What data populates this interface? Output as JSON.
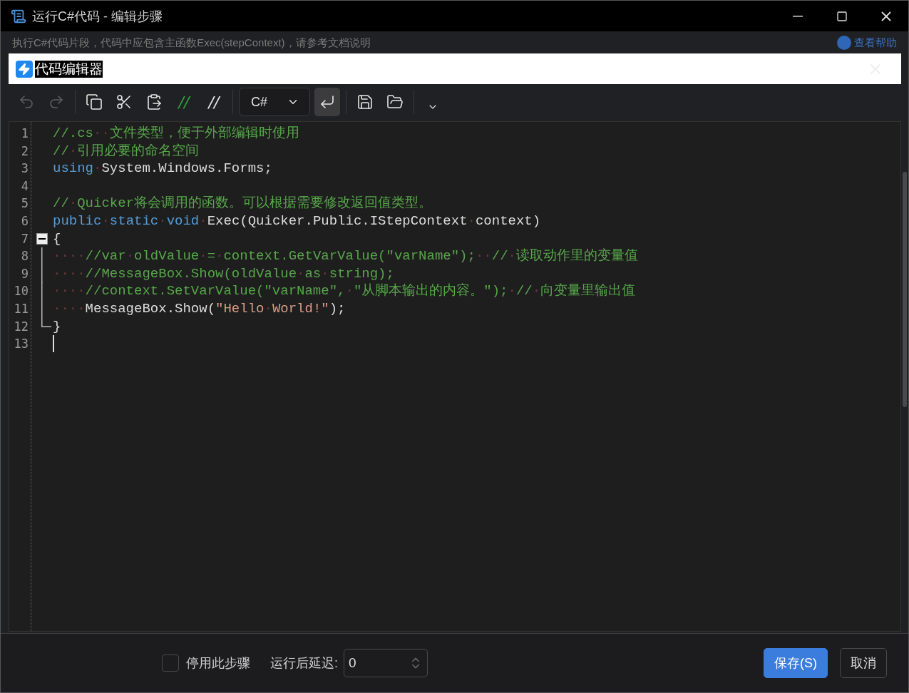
{
  "window": {
    "title": "运行C#代码 - 编辑步骤"
  },
  "background": {
    "description": "执行C#代码片段，代码中应包含主函数Exec(stepContext)，请参考文档说明",
    "help_link": "查看帮助"
  },
  "dialog": {
    "title": "代码编辑器"
  },
  "toolbar": [
    {
      "kind": "undo",
      "disabled": true,
      "selected": false
    },
    {
      "kind": "redo",
      "disabled": true,
      "selected": false
    },
    {
      "kind": "sep"
    },
    {
      "kind": "copy",
      "disabled": false,
      "selected": false
    },
    {
      "kind": "cut",
      "disabled": false,
      "selected": false
    },
    {
      "kind": "paste",
      "disabled": false,
      "selected": false
    },
    {
      "kind": "comment",
      "label": "//",
      "disabled": false,
      "selected": false
    },
    {
      "kind": "uncomment",
      "label": "//",
      "disabled": false,
      "selected": false
    },
    {
      "kind": "sep"
    },
    {
      "kind": "language",
      "value": "C#"
    },
    {
      "kind": "wrap",
      "disabled": false,
      "selected": true
    },
    {
      "kind": "sep"
    },
    {
      "kind": "save",
      "disabled": false,
      "selected": false
    },
    {
      "kind": "open",
      "disabled": false,
      "selected": false
    },
    {
      "kind": "sep"
    },
    {
      "kind": "more",
      "disabled": false,
      "selected": false
    }
  ],
  "editor": {
    "lines": [
      {
        "number": "1",
        "tokens": [
          {
            "kind": "comment",
            "t": "//.cs"
          },
          {
            "kind": "ws",
            "t": "··"
          },
          {
            "kind": "comment",
            "t": "文件类型，便于外部编辑时使用"
          }
        ]
      },
      {
        "number": "2",
        "tokens": [
          {
            "kind": "comment",
            "t": "//"
          },
          {
            "kind": "ws",
            "t": "·"
          },
          {
            "kind": "comment",
            "t": "引用必要的命名空间"
          }
        ]
      },
      {
        "number": "3",
        "tokens": [
          {
            "kind": "keyword",
            "t": "using"
          },
          {
            "kind": "ws",
            "t": "·"
          },
          {
            "kind": "plain",
            "t": "System.Windows.Forms;"
          }
        ]
      },
      {
        "number": "4"
      },
      {
        "number": "5",
        "tokens": [
          {
            "kind": "comment",
            "t": "//"
          },
          {
            "kind": "ws",
            "t": "·"
          },
          {
            "kind": "comment",
            "t": "Quicker将会调用的函数。可以根据需要修改返回值类型。"
          }
        ]
      },
      {
        "number": "6",
        "tokens": [
          {
            "kind": "keyword",
            "t": "public"
          },
          {
            "kind": "ws",
            "t": "·"
          },
          {
            "kind": "keyword",
            "t": "static"
          },
          {
            "kind": "ws",
            "t": "·"
          },
          {
            "kind": "keyword",
            "t": "void"
          },
          {
            "kind": "ws",
            "t": "·"
          },
          {
            "kind": "plain",
            "t": "Exec(Quicker.Public.IStepContext"
          },
          {
            "kind": "ws",
            "t": "·"
          },
          {
            "kind": "plain",
            "t": "context)"
          }
        ]
      },
      {
        "number": "7",
        "kind": "fold_start",
        "tokens": [
          {
            "kind": "plain",
            "t": "{"
          }
        ]
      },
      {
        "number": "8",
        "kind": "fold_body",
        "tokens": [
          {
            "kind": "ws",
            "t": "····"
          },
          {
            "kind": "comment",
            "t": "//var"
          },
          {
            "kind": "ws",
            "t": "·"
          },
          {
            "kind": "comment",
            "t": "oldValue"
          },
          {
            "kind": "ws",
            "t": "·"
          },
          {
            "kind": "comment",
            "t": "="
          },
          {
            "kind": "ws",
            "t": "·"
          },
          {
            "kind": "comment",
            "t": "context.GetVarValue(\"varName\");"
          },
          {
            "kind": "ws",
            "t": "··"
          },
          {
            "kind": "comment",
            "t": "//"
          },
          {
            "kind": "ws",
            "t": "·"
          },
          {
            "kind": "comment",
            "t": "读取动作里的变量值"
          }
        ]
      },
      {
        "number": "9",
        "kind": "fold_body",
        "tokens": [
          {
            "kind": "ws",
            "t": "····"
          },
          {
            "kind": "comment",
            "t": "//MessageBox.Show(oldValue"
          },
          {
            "kind": "ws",
            "t": "·"
          },
          {
            "kind": "comment",
            "t": "as"
          },
          {
            "kind": "ws",
            "t": "·"
          },
          {
            "kind": "comment",
            "t": "string);"
          }
        ]
      },
      {
        "number": "10",
        "kind": "fold_body",
        "tokens": [
          {
            "kind": "ws",
            "t": "····"
          },
          {
            "kind": "comment",
            "t": "//context.SetVarValue(\"varName\","
          },
          {
            "kind": "ws",
            "t": "·"
          },
          {
            "kind": "comment",
            "t": "\"从脚本输出的内容。\");"
          },
          {
            "kind": "ws",
            "t": "·"
          },
          {
            "kind": "comment",
            "t": "//"
          },
          {
            "kind": "ws",
            "t": "·"
          },
          {
            "kind": "comment",
            "t": "向变量里输出值"
          }
        ]
      },
      {
        "number": "11",
        "kind": "fold_body",
        "tokens": [
          {
            "kind": "ws",
            "t": "····"
          },
          {
            "kind": "plain",
            "t": "MessageBox.Show("
          },
          {
            "kind": "string",
            "t": "\"Hello"
          },
          {
            "kind": "ws",
            "t": "·"
          },
          {
            "kind": "string",
            "t": "World!\""
          },
          {
            "kind": "plain",
            "t": ");"
          }
        ]
      },
      {
        "number": "12",
        "kind": "fold_end",
        "tokens": [
          {
            "kind": "plain",
            "t": "}"
          }
        ]
      },
      {
        "number": "13",
        "caret": true
      }
    ]
  },
  "footer": {
    "disable_step": {
      "label": "停用此步骤",
      "checked": false
    },
    "delay": {
      "label": "运行后延迟:",
      "value": "0"
    },
    "buttons": [
      {
        "label": "保存(S)",
        "primary": true
      },
      {
        "label": "取消",
        "primary": false
      }
    ]
  }
}
